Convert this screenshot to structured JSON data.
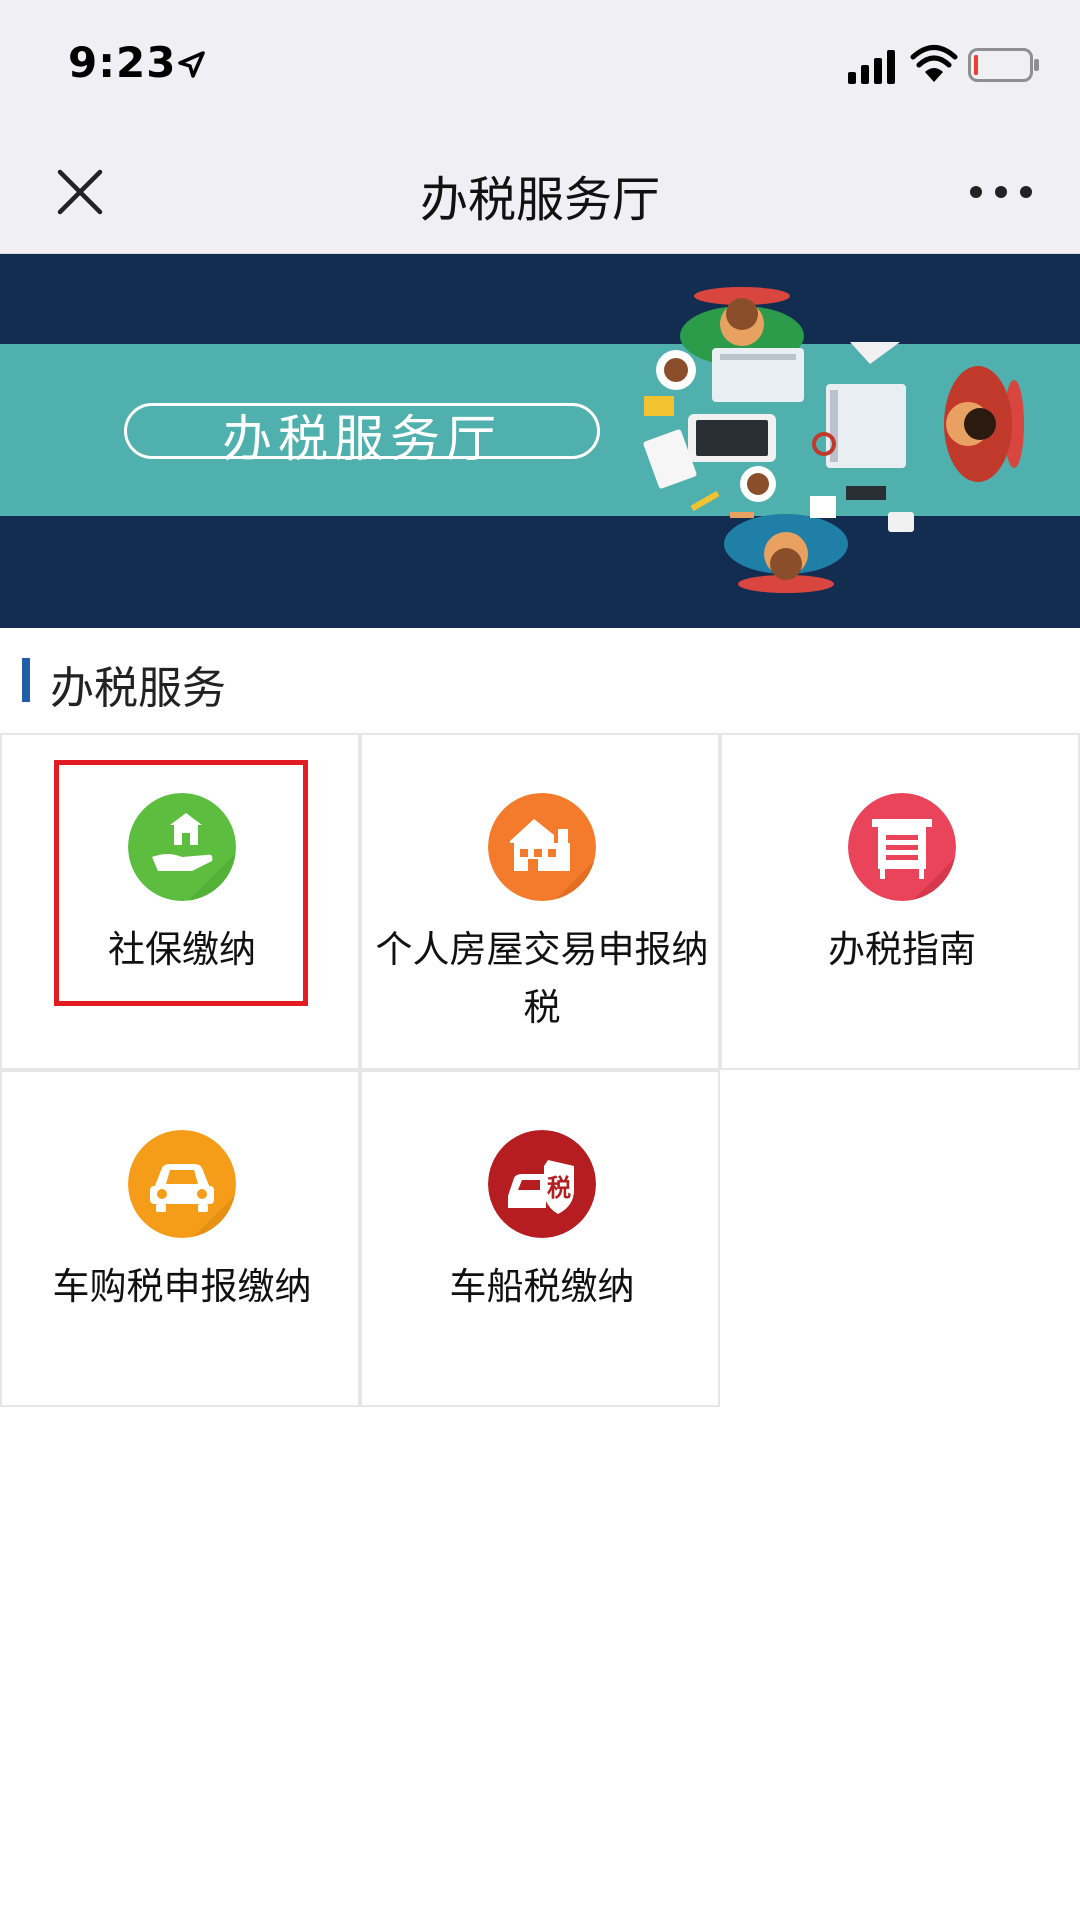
{
  "status_bar": {
    "time": "9:23"
  },
  "nav": {
    "title": "办税服务厅"
  },
  "banner": {
    "title": "办税服务厅"
  },
  "section": {
    "title": "办税服务"
  },
  "services": [
    {
      "label": "社保缴纳",
      "icon": "social-security-hand-icon",
      "color": "#5cbd3f"
    },
    {
      "label": "个人房屋交易申报纳税",
      "icon": "house-icon",
      "color": "#f47b2b"
    },
    {
      "label": "办税指南",
      "icon": "guide-board-icon",
      "color": "#e9445a"
    },
    {
      "label": "车购税申报缴纳",
      "icon": "car-icon",
      "color": "#f59d19"
    },
    {
      "label": "车船税缴纳",
      "icon": "car-tax-shield-icon",
      "color": "#b51d20",
      "badge": "税"
    }
  ],
  "colors": {
    "accent": "#1f5fa8",
    "highlight": "#e31b23",
    "banner_dark": "#122d4f",
    "banner_band": "#4fb0ad"
  }
}
